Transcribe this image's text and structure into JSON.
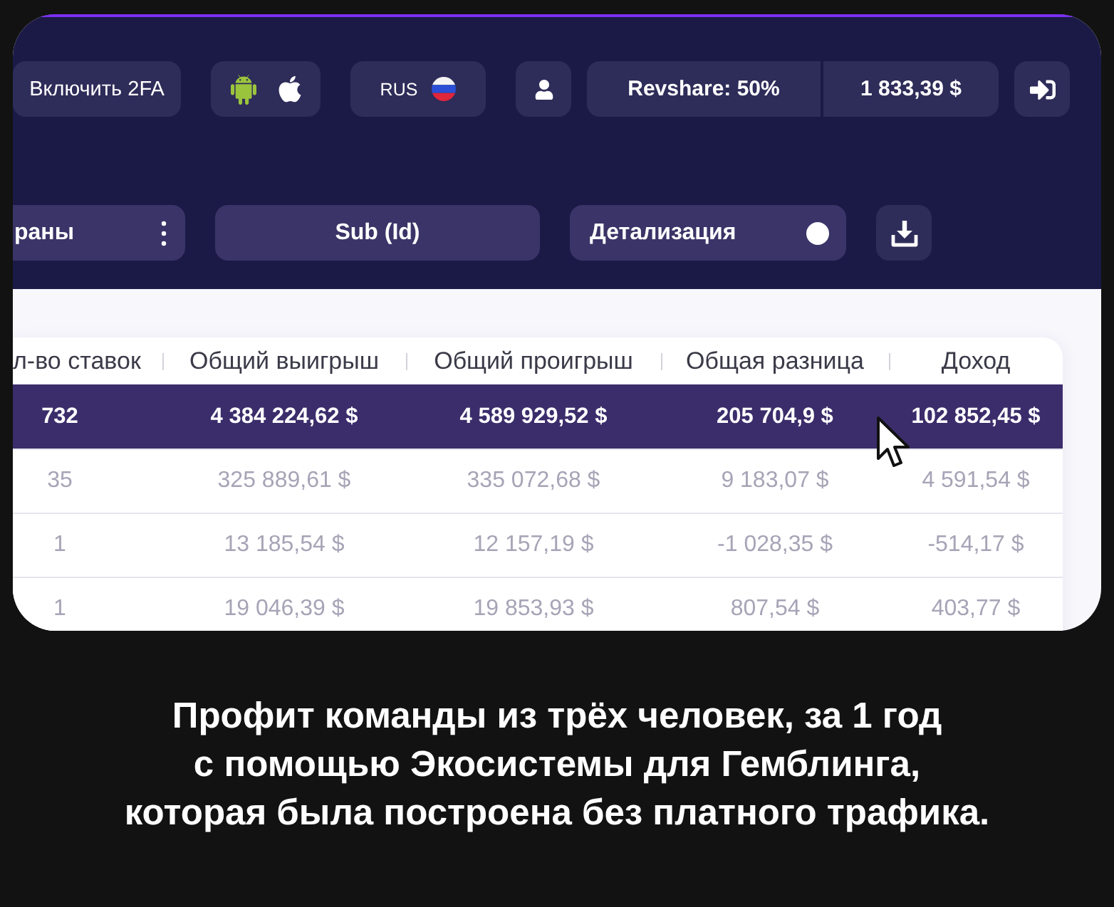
{
  "header": {
    "twofa_button": "Включить 2FA",
    "language": "RUS",
    "revshare": "Revshare: 50%",
    "balance": "1 833,39 $"
  },
  "filters": {
    "country_select": "раны",
    "sub_id_button": "Sub (Id)",
    "details_toggle": {
      "label": "Детализация",
      "on": true
    }
  },
  "table": {
    "columns": [
      "л-во ставок",
      "Общий выигрыш",
      "Общий проигрыш",
      "Общая разница",
      "Доход"
    ],
    "rows": [
      {
        "selected": true,
        "cells": [
          "732",
          "4 384 224,62 $",
          "4 589 929,52 $",
          "205 704,9 $",
          "102 852,45 $"
        ]
      },
      {
        "selected": false,
        "cells": [
          "35",
          "325 889,61 $",
          "335 072,68 $",
          "9 183,07 $",
          "4 591,54 $"
        ]
      },
      {
        "selected": false,
        "cells": [
          "1",
          "13 185,54 $",
          "12 157,19 $",
          "-1 028,35 $",
          "-514,17 $"
        ]
      },
      {
        "selected": false,
        "cells": [
          "1",
          "19 046,39 $",
          "19 853,93 $",
          "807,54 $",
          "403,77 $"
        ]
      }
    ]
  },
  "caption": [
    "Профит команды из трёх человек, за 1 год",
    "с помощью Экосистемы для Гемблинга,",
    "которая была построена без платного трафика."
  ]
}
